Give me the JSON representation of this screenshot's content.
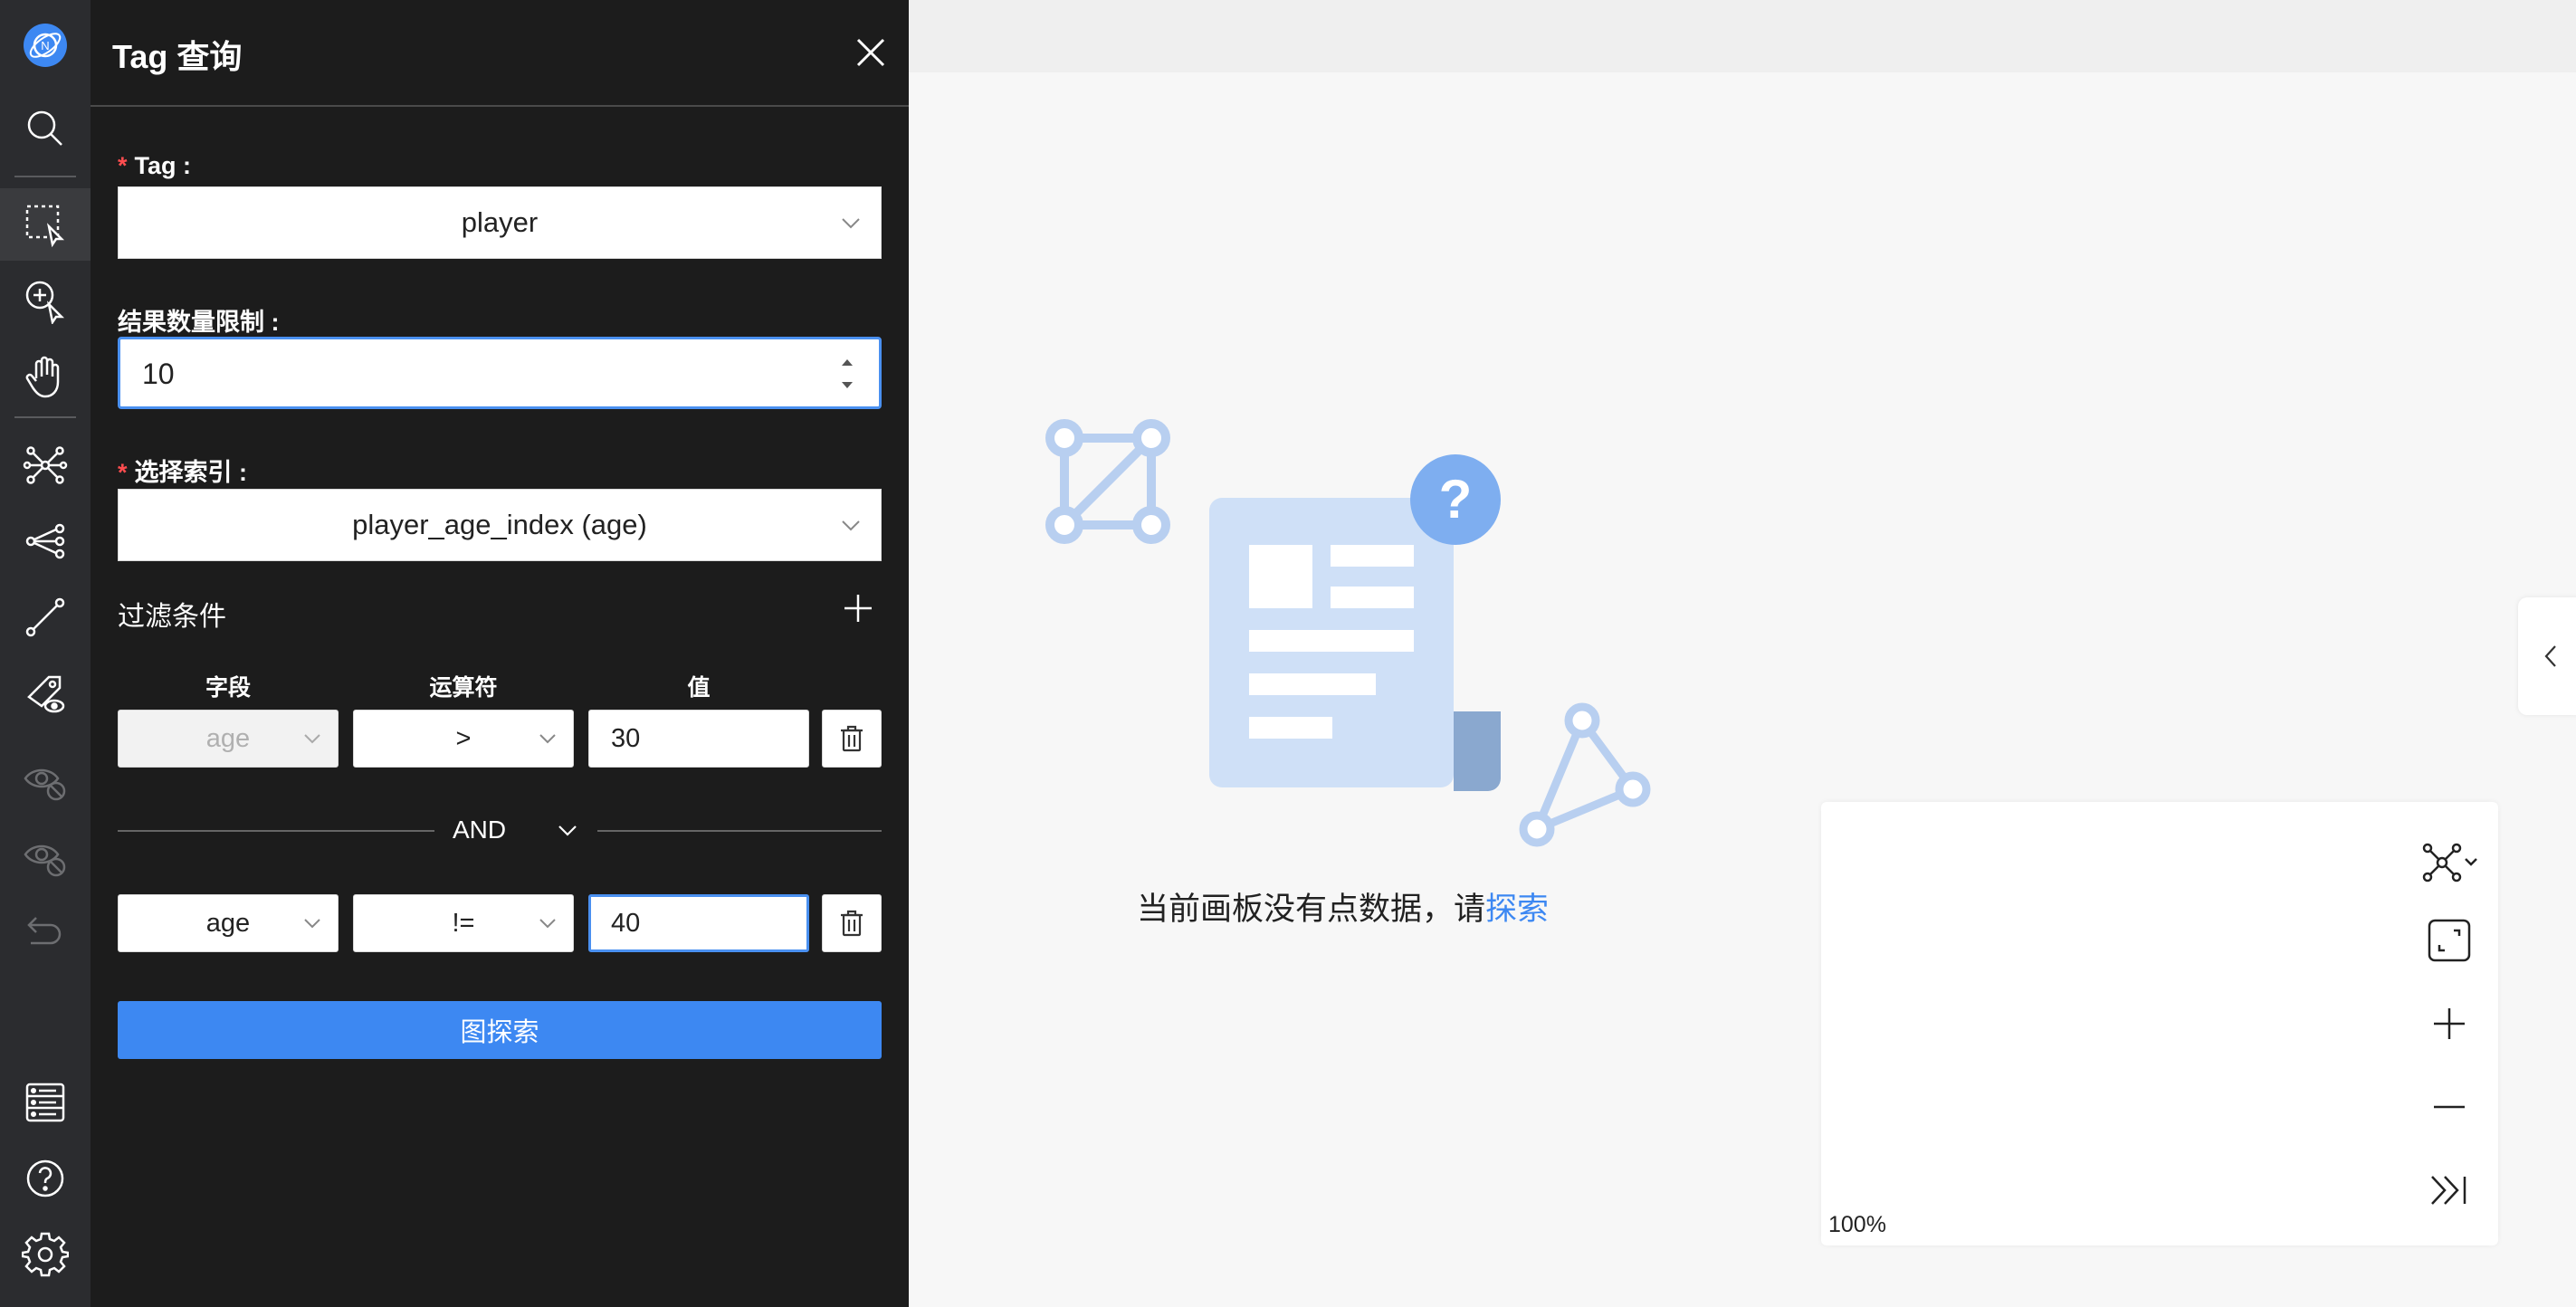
{
  "drawer": {
    "title": "Tag 查询",
    "tag_label": "Tag :",
    "tag_value": "player",
    "limit_label": "结果数量限制 :",
    "limit_value": "10",
    "index_label": "选择索引 :",
    "index_value": "player_age_index (age)",
    "filter_title": "过滤条件",
    "columns": {
      "field": "字段",
      "operator": "运算符",
      "value": "值"
    },
    "conditions": [
      {
        "field": "age",
        "operator": ">",
        "value": "30"
      },
      {
        "field": "age",
        "operator": "!=",
        "value": "40"
      }
    ],
    "connector": "AND",
    "explore_button": "图探索"
  },
  "canvas": {
    "empty_message": "当前画板没有点数据，请",
    "empty_link": "探索",
    "zoom_level": "100%"
  },
  "colors": {
    "accent": "#3d88f2",
    "required": "#ff4d4f",
    "drawer_bg": "#1c1c1c",
    "rail_bg": "#2b2c2f"
  },
  "icons": {
    "rail": [
      "logo-icon",
      "search-icon",
      "select-icon",
      "node-expand-icon",
      "hand-icon",
      "graph-icon",
      "share-icon",
      "edge-icon",
      "tag-view-icon",
      "hide-icon",
      "hide-all-icon",
      "undo-icon",
      "list-icon",
      "help-icon",
      "settings-icon"
    ],
    "mini": [
      "layout-icon",
      "fit-icon",
      "zoom-in-icon",
      "zoom-out-icon",
      "collapse-icon"
    ]
  }
}
